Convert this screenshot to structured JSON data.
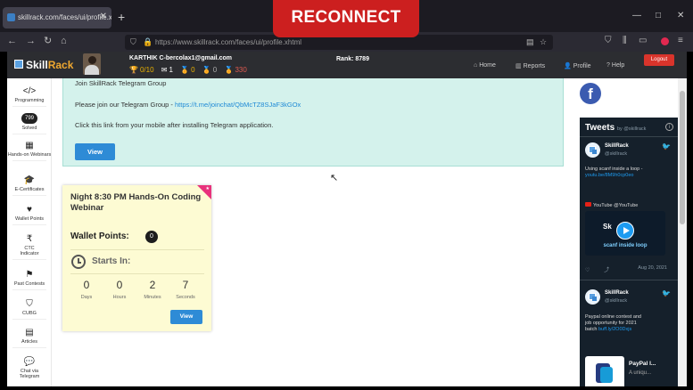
{
  "reconnect": {
    "label": "RECONNECT"
  },
  "browser": {
    "tab_title": "skillrack.com/faces/ui/profile.x",
    "tab_close": "✕",
    "new_tab": "+",
    "url": "https://www.skillrack.com/faces/ui/profile.xhtml",
    "window": {
      "minimize": "—",
      "maximize": "□",
      "close": "✕"
    }
  },
  "header": {
    "logo_text_a": "Skill",
    "logo_text_b": "Rack",
    "user_name": "KARTHIK C-bercolax1@gmail.com",
    "stats": {
      "trophy": "0/10",
      "badge": "1",
      "gold": "0",
      "silver": "0",
      "red": "330"
    },
    "rank": "Rank: 8789",
    "nav": {
      "home": "Home",
      "reports": "Reports",
      "profile": "Profile",
      "help": "Help"
    },
    "logout": "Logout"
  },
  "sidebar": {
    "items": [
      {
        "icon": "</>",
        "label": "Programming"
      },
      {
        "badge": "799",
        "label": "Solved"
      },
      {
        "icon": "▦",
        "label": "Hands-on Webinars"
      },
      {
        "icon": "🎓",
        "label": "E-Certificates"
      },
      {
        "icon": "♥",
        "label": "Wallet Points"
      },
      {
        "icon": "₹",
        "label": "CTC Indicator"
      },
      {
        "icon": "⚑",
        "label": "Past Contests"
      },
      {
        "icon": "⛉",
        "label": "CUBG"
      },
      {
        "icon": "▤",
        "label": "Articles"
      },
      {
        "icon": "💬",
        "label": "Chat via Telegram"
      }
    ]
  },
  "telegram": {
    "title": "Join SkillRack Telegram Group",
    "line1_text": "Please join our Telegram Group - ",
    "line1_link": "https://t.me/joinchat/QbMcTZ8SJaF3kGOx",
    "line2": "Click this link from your mobile after installing Telegram application.",
    "view": "View"
  },
  "webinar": {
    "title": "Night 8:30 PM Hands-On Coding Webinar",
    "wallet_label": "Wallet Points:",
    "wallet_value": "0",
    "starts_in": "Starts In:",
    "countdown": [
      {
        "value": "0",
        "unit": "Days"
      },
      {
        "value": "0",
        "unit": "Hours"
      },
      {
        "value": "2",
        "unit": "Minutes"
      },
      {
        "value": "7",
        "unit": "Seconds"
      }
    ],
    "view": "View"
  },
  "tweets": {
    "title": "Tweets",
    "by": "by @skillrack",
    "tweet1": {
      "name": "SkillRack",
      "handle": "@skillrack",
      "text": "Using scanf inside a loop -",
      "link": "youtu.be/8M9h0cp0eo",
      "yt_label": "YouTube @YouTube",
      "media_logo": "Sk",
      "media_caption": "scanf inside loop",
      "date": "Aug 20, 2021"
    },
    "tweet2": {
      "name": "SkillRack",
      "handle": "@skillrack",
      "text": "Paypal online contest and job opportunity for 2021 batch",
      "link": "buff.ly/2O0Dxjs",
      "card_title": "PayPal I...",
      "card_sub": "A uniqu..."
    }
  },
  "icons": {
    "facebook": "f",
    "twitter": "🐦",
    "cursor": "↖"
  },
  "colors": {
    "accent_blue": "#2e8bd6",
    "telegram_bg": "#d4f2ec",
    "webinar_bg": "#fdfbd3",
    "reconnect": "#cc1f1f",
    "logout": "#d9342b"
  }
}
